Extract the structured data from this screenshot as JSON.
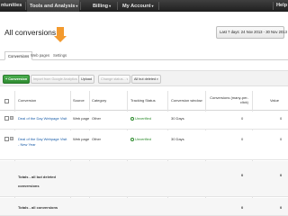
{
  "nav": {
    "items": [
      {
        "label": "ntunities"
      },
      {
        "label": "Tools and Analysis"
      },
      {
        "label": "Billing"
      },
      {
        "label": "My Account"
      }
    ],
    "help": "Help"
  },
  "page_title": "All conversions",
  "date_range": "Last 7 days: 24 Nov 2013 - 30 Nov 2013",
  "tabs": [
    {
      "label": "Conversions"
    },
    {
      "label": "Web pages"
    },
    {
      "label": "Settings"
    }
  ],
  "toolbar": {
    "add_conversion": "+ Conversion",
    "import_analytics": "Import from Google Analytics",
    "upload": "Upload",
    "change_status": "Change status...",
    "filter": "All but deleted"
  },
  "table": {
    "headers": {
      "conversion": "Conversion",
      "source": "Source",
      "category": "Category",
      "tracking_status": "Tracking Status",
      "conversion_window": "Conversion window",
      "conversions_many": "Conversions (many-per-click)",
      "value": "Value"
    },
    "rows": [
      {
        "name": "Deal of the Day Webpage Visit",
        "source": "Web page",
        "category": "Other",
        "status": "Unverified",
        "window": "30 Days",
        "conversions": "0",
        "value": "0"
      },
      {
        "name": "Deal of the Day Webpage Visit - New Year",
        "source": "Web page",
        "category": "Other",
        "status": "Unverified",
        "window": "30 Days",
        "conversions": "0",
        "value": "0"
      }
    ],
    "totals": [
      {
        "label": "Totals - all but deleted conversions",
        "conversions": "0",
        "value": "0"
      },
      {
        "label": "Totals - all conversions",
        "conversions": "0",
        "value": "0"
      }
    ]
  },
  "colors": {
    "nav_bg": "#2b2b2b",
    "primary_green": "#3a9a3c",
    "link_blue": "#1a5da8",
    "status_green": "#2a8a2a",
    "annotation_orange": "#f39a2e"
  }
}
